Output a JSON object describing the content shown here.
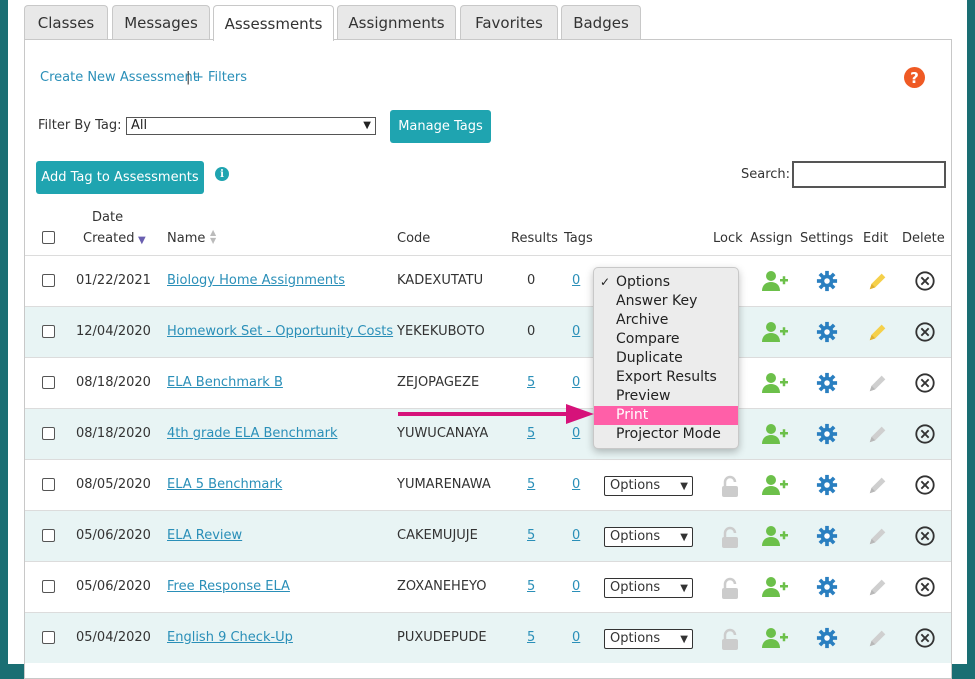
{
  "tabs": [
    "Classes",
    "Messages",
    "Assessments",
    "Assignments",
    "Favorites",
    "Badges"
  ],
  "active_tab": "Assessments",
  "toolbar": {
    "create_link": "Create New Assessment",
    "separator": "|",
    "filters_link": "+ Filters",
    "help_icon": "?",
    "filter_label": "Filter By Tag:",
    "filter_value": "All",
    "manage_tags": "Manage Tags",
    "add_tag": "Add Tag to Assessments",
    "info_icon": "i",
    "search_label": "Search:",
    "search_value": ""
  },
  "columns": {
    "date_line1": "Date",
    "date_line2": "Created",
    "name": "Name",
    "code": "Code",
    "results": "Results",
    "tags": "Tags",
    "lock": "Lock",
    "assign": "Assign",
    "settings": "Settings",
    "edit": "Edit",
    "delete": "Delete"
  },
  "rows": [
    {
      "date": "01/22/2021",
      "name": "Biology Home Assignments",
      "code": "KADEXUTATU",
      "results": "0",
      "tags": "0",
      "options": "Options",
      "edit_active": true
    },
    {
      "date": "12/04/2020",
      "name": "Homework Set - Opportunity Costs",
      "code": "YEKEKUBOTO",
      "results": "0",
      "tags": "0",
      "options": "Options",
      "edit_active": true
    },
    {
      "date": "08/18/2020",
      "name": "ELA Benchmark B",
      "code": "ZEJOPAGEZE",
      "results": "5",
      "tags": "0",
      "options": "Options",
      "edit_active": false
    },
    {
      "date": "08/18/2020",
      "name": "4th grade ELA Benchmark",
      "code": "YUWUCANAYA",
      "results": "5",
      "tags": "0",
      "options": "Options",
      "edit_active": false
    },
    {
      "date": "08/05/2020",
      "name": "ELA 5 Benchmark",
      "code": "YUMARENAWA",
      "results": "5",
      "tags": "0",
      "options": "Options",
      "edit_active": false
    },
    {
      "date": "05/06/2020",
      "name": "ELA Review",
      "code": "CAKEMUJUJE",
      "results": "5",
      "tags": "0",
      "options": "Options",
      "edit_active": false
    },
    {
      "date": "05/06/2020",
      "name": "Free Response ELA",
      "code": "ZOXANEHEYO",
      "results": "5",
      "tags": "0",
      "options": "Options",
      "edit_active": false
    },
    {
      "date": "05/04/2020",
      "name": "English 9 Check-Up",
      "code": "PUXUDEPUDE",
      "results": "5",
      "tags": "0",
      "options": "Options",
      "edit_active": false
    }
  ],
  "dropdown": {
    "check": "✓",
    "items": [
      "Options",
      "Answer Key",
      "Archive",
      "Compare",
      "Duplicate",
      "Export Results",
      "Preview",
      "Print",
      "Projector Mode"
    ],
    "selected": "Options",
    "highlighted": "Print"
  },
  "colors": {
    "teal": "#1fa4b0",
    "link": "#2a8fb8",
    "highlight": "#ff5fa8",
    "arrow": "#d6127a",
    "assign_green": "#6cc04a",
    "settings_blue": "#2a7fc0",
    "edit_yellow": "#f5d04a"
  }
}
